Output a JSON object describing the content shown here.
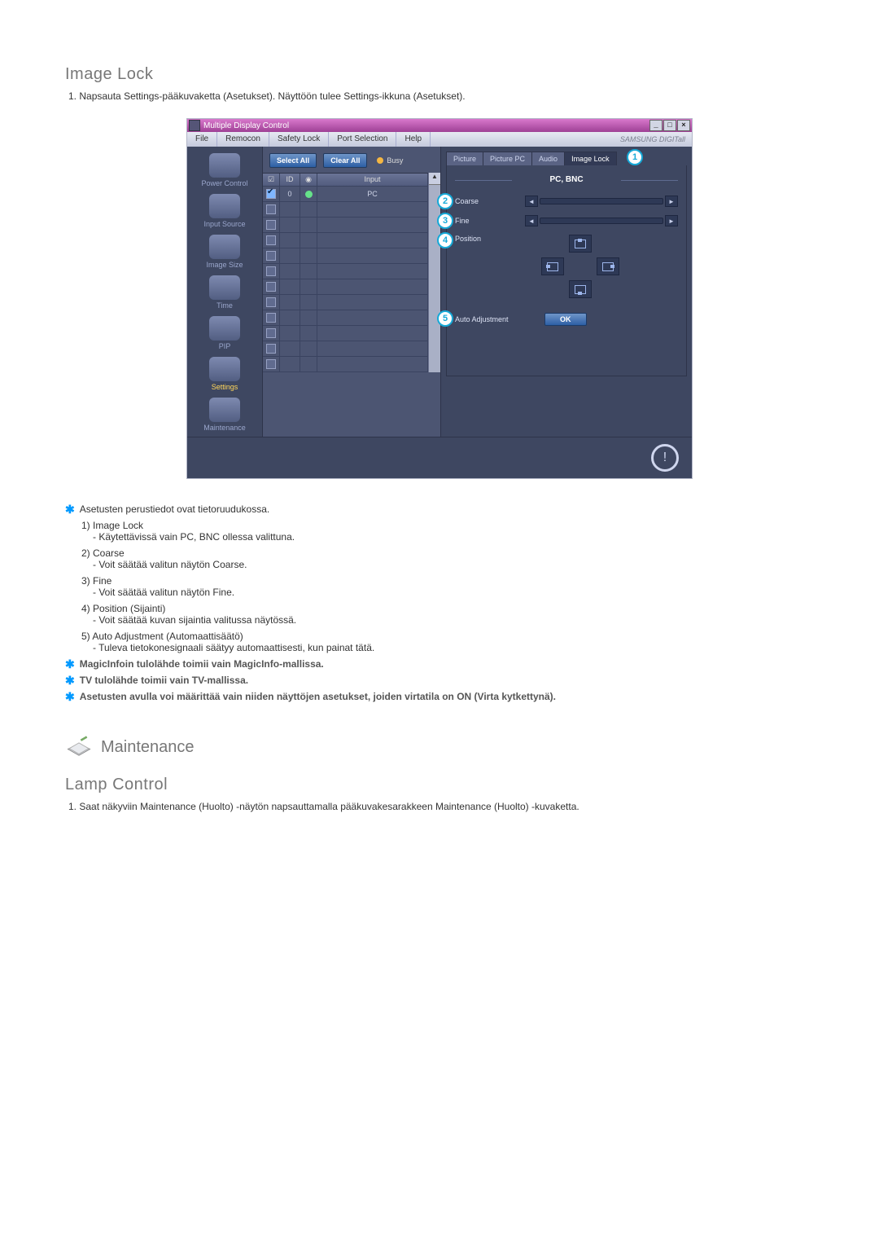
{
  "section1": {
    "heading": "Image Lock",
    "intro_num": "1.",
    "intro_text": "Napsauta Settings-pääkuvaketta (Asetukset). Näyttöön tulee Settings-ikkuna (Asetukset)."
  },
  "app": {
    "title": "Multiple Display Control",
    "winbtn_min": "_",
    "winbtn_max": "□",
    "winbtn_close": "×",
    "menu": {
      "file": "File",
      "remocon": "Remocon",
      "safety": "Safety Lock",
      "port": "Port Selection",
      "help": "Help",
      "brand": "SAMSUNG DIGITall"
    },
    "sidebar": {
      "power": "Power Control",
      "input": "Input Source",
      "image": "Image Size",
      "time": "Time",
      "pip": "PIP",
      "settings": "Settings",
      "maint": "Maintenance"
    },
    "toolbar": {
      "select_all": "Select All",
      "clear_all": "Clear All",
      "busy": "Busy"
    },
    "grid": {
      "h_chk": "☑",
      "h_id": "ID",
      "h_dot": "◉",
      "h_input": "Input",
      "id0": "0",
      "val0": "PC"
    },
    "tabs": {
      "picture": "Picture",
      "picture_pc": "Picture PC",
      "audio": "Audio",
      "image_lock": "Image Lock"
    },
    "panel": {
      "subhead": "PC, BNC",
      "coarse": "Coarse",
      "fine": "Fine",
      "position": "Position",
      "auto": "Auto Adjustment",
      "ok": "OK"
    },
    "callouts": {
      "c1": "1",
      "c2": "2",
      "c3": "3",
      "c4": "4",
      "c5": "5"
    },
    "info_glyph": "!"
  },
  "notes": {
    "n0": "Asetusten perustiedot ovat tietoruudukossa.",
    "l1t": "1)  Image Lock",
    "l1d": "- Käytettävissä vain PC, BNC ollessa valittuna.",
    "l2t": "2)  Coarse",
    "l2d": "- Voit säätää valitun näytön Coarse.",
    "l3t": "3)  Fine",
    "l3d": "- Voit säätää valitun näytön Fine.",
    "l4t": "4)  Position (Sijainti)",
    "l4d": "- Voit säätää kuvan sijaintia valitussa näytössä.",
    "l5t": "5)  Auto Adjustment (Automaattisäätö)",
    "l5d": "- Tuleva tietokonesignaali säätyy automaattisesti, kun painat tätä.",
    "n1": "MagicInfoin tulolähde toimii vain MagicInfo-mallissa.",
    "n2": "TV tulolähde toimii vain TV-mallissa.",
    "n3": "Asetusten avulla voi määrittää vain niiden näyttöjen asetukset, joiden virtatila on ON (Virta kytkettynä)."
  },
  "section2": {
    "heading": "Maintenance",
    "sub_heading": "Lamp Control",
    "intro_num": "1.",
    "intro_text": "Saat näkyviin Maintenance (Huolto) -näytön napsauttamalla pääkuvakesarakkeen Maintenance (Huolto) -kuvaketta."
  }
}
